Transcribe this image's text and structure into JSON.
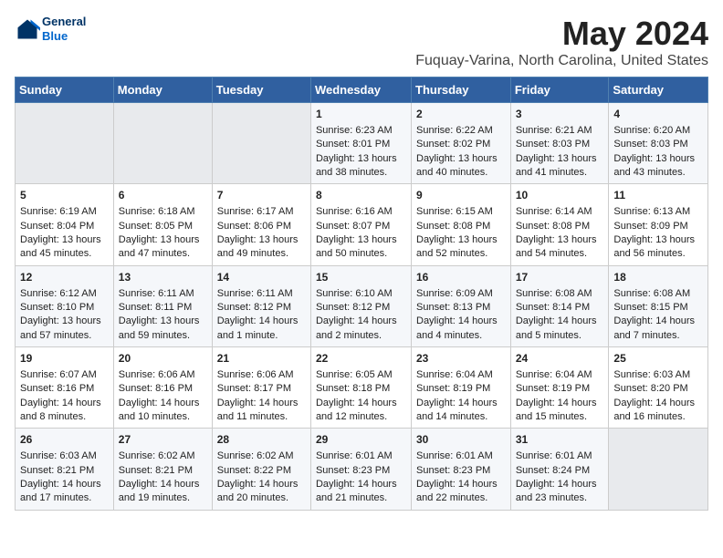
{
  "logo": {
    "line1": "General",
    "line2": "Blue"
  },
  "title": "May 2024",
  "subtitle": "Fuquay-Varina, North Carolina, United States",
  "days_of_week": [
    "Sunday",
    "Monday",
    "Tuesday",
    "Wednesday",
    "Thursday",
    "Friday",
    "Saturday"
  ],
  "weeks": [
    [
      {
        "day": "",
        "info": ""
      },
      {
        "day": "",
        "info": ""
      },
      {
        "day": "",
        "info": ""
      },
      {
        "day": "1",
        "info": "Sunrise: 6:23 AM\nSunset: 8:01 PM\nDaylight: 13 hours and 38 minutes."
      },
      {
        "day": "2",
        "info": "Sunrise: 6:22 AM\nSunset: 8:02 PM\nDaylight: 13 hours and 40 minutes."
      },
      {
        "day": "3",
        "info": "Sunrise: 6:21 AM\nSunset: 8:03 PM\nDaylight: 13 hours and 41 minutes."
      },
      {
        "day": "4",
        "info": "Sunrise: 6:20 AM\nSunset: 8:03 PM\nDaylight: 13 hours and 43 minutes."
      }
    ],
    [
      {
        "day": "5",
        "info": "Sunrise: 6:19 AM\nSunset: 8:04 PM\nDaylight: 13 hours and 45 minutes."
      },
      {
        "day": "6",
        "info": "Sunrise: 6:18 AM\nSunset: 8:05 PM\nDaylight: 13 hours and 47 minutes."
      },
      {
        "day": "7",
        "info": "Sunrise: 6:17 AM\nSunset: 8:06 PM\nDaylight: 13 hours and 49 minutes."
      },
      {
        "day": "8",
        "info": "Sunrise: 6:16 AM\nSunset: 8:07 PM\nDaylight: 13 hours and 50 minutes."
      },
      {
        "day": "9",
        "info": "Sunrise: 6:15 AM\nSunset: 8:08 PM\nDaylight: 13 hours and 52 minutes."
      },
      {
        "day": "10",
        "info": "Sunrise: 6:14 AM\nSunset: 8:08 PM\nDaylight: 13 hours and 54 minutes."
      },
      {
        "day": "11",
        "info": "Sunrise: 6:13 AM\nSunset: 8:09 PM\nDaylight: 13 hours and 56 minutes."
      }
    ],
    [
      {
        "day": "12",
        "info": "Sunrise: 6:12 AM\nSunset: 8:10 PM\nDaylight: 13 hours and 57 minutes."
      },
      {
        "day": "13",
        "info": "Sunrise: 6:11 AM\nSunset: 8:11 PM\nDaylight: 13 hours and 59 minutes."
      },
      {
        "day": "14",
        "info": "Sunrise: 6:11 AM\nSunset: 8:12 PM\nDaylight: 14 hours and 1 minute."
      },
      {
        "day": "15",
        "info": "Sunrise: 6:10 AM\nSunset: 8:12 PM\nDaylight: 14 hours and 2 minutes."
      },
      {
        "day": "16",
        "info": "Sunrise: 6:09 AM\nSunset: 8:13 PM\nDaylight: 14 hours and 4 minutes."
      },
      {
        "day": "17",
        "info": "Sunrise: 6:08 AM\nSunset: 8:14 PM\nDaylight: 14 hours and 5 minutes."
      },
      {
        "day": "18",
        "info": "Sunrise: 6:08 AM\nSunset: 8:15 PM\nDaylight: 14 hours and 7 minutes."
      }
    ],
    [
      {
        "day": "19",
        "info": "Sunrise: 6:07 AM\nSunset: 8:16 PM\nDaylight: 14 hours and 8 minutes."
      },
      {
        "day": "20",
        "info": "Sunrise: 6:06 AM\nSunset: 8:16 PM\nDaylight: 14 hours and 10 minutes."
      },
      {
        "day": "21",
        "info": "Sunrise: 6:06 AM\nSunset: 8:17 PM\nDaylight: 14 hours and 11 minutes."
      },
      {
        "day": "22",
        "info": "Sunrise: 6:05 AM\nSunset: 8:18 PM\nDaylight: 14 hours and 12 minutes."
      },
      {
        "day": "23",
        "info": "Sunrise: 6:04 AM\nSunset: 8:19 PM\nDaylight: 14 hours and 14 minutes."
      },
      {
        "day": "24",
        "info": "Sunrise: 6:04 AM\nSunset: 8:19 PM\nDaylight: 14 hours and 15 minutes."
      },
      {
        "day": "25",
        "info": "Sunrise: 6:03 AM\nSunset: 8:20 PM\nDaylight: 14 hours and 16 minutes."
      }
    ],
    [
      {
        "day": "26",
        "info": "Sunrise: 6:03 AM\nSunset: 8:21 PM\nDaylight: 14 hours and 17 minutes."
      },
      {
        "day": "27",
        "info": "Sunrise: 6:02 AM\nSunset: 8:21 PM\nDaylight: 14 hours and 19 minutes."
      },
      {
        "day": "28",
        "info": "Sunrise: 6:02 AM\nSunset: 8:22 PM\nDaylight: 14 hours and 20 minutes."
      },
      {
        "day": "29",
        "info": "Sunrise: 6:01 AM\nSunset: 8:23 PM\nDaylight: 14 hours and 21 minutes."
      },
      {
        "day": "30",
        "info": "Sunrise: 6:01 AM\nSunset: 8:23 PM\nDaylight: 14 hours and 22 minutes."
      },
      {
        "day": "31",
        "info": "Sunrise: 6:01 AM\nSunset: 8:24 PM\nDaylight: 14 hours and 23 minutes."
      },
      {
        "day": "",
        "info": ""
      }
    ]
  ]
}
